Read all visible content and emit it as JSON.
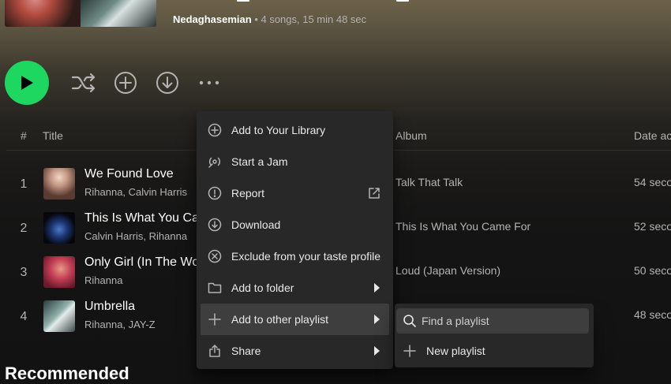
{
  "header": {
    "owner": "Nedaghasemian",
    "meta": " • 4 songs, 15 min 48 sec"
  },
  "table": {
    "col_number": "#",
    "col_title": "Title",
    "col_album": "Album",
    "col_date": "Date ac",
    "rows": [
      {
        "number": "1",
        "title": "We Found Love",
        "artists": "Rihanna, Calvin Harris",
        "album": "Talk That Talk",
        "date": "54 seco"
      },
      {
        "number": "2",
        "title": "This Is What You Car",
        "artists": "Calvin Harris, Rihanna",
        "album": "This Is What You Came For",
        "date": "52 seco"
      },
      {
        "number": "3",
        "title": "Only Girl (In The Wo",
        "artists": "Rihanna",
        "album": "Loud (Japan Version)",
        "date": "50 seco"
      },
      {
        "number": "4",
        "title": "Umbrella",
        "artists": "Rihanna, JAY-Z",
        "album": "",
        "date": "48 seco"
      }
    ]
  },
  "section": {
    "recommended": "Recommended"
  },
  "context_menu": {
    "items": [
      {
        "label": "Add to Your Library",
        "icon": "plus-circle-icon"
      },
      {
        "label": "Start a Jam",
        "icon": "jam-icon"
      },
      {
        "label": "Report",
        "icon": "report-icon"
      },
      {
        "label": "Download",
        "icon": "download-icon"
      },
      {
        "label": "Exclude from your taste profile",
        "icon": "exclude-icon"
      },
      {
        "label": "Add to folder",
        "icon": "folder-icon"
      },
      {
        "label": "Add to other playlist",
        "icon": "plus-icon"
      },
      {
        "label": "Share",
        "icon": "share-icon"
      }
    ]
  },
  "submenu": {
    "search_placeholder": "Find a playlist",
    "new_playlist": "New playlist"
  },
  "colors": {
    "accent": "#1ed760",
    "background": "#121212",
    "menu": "#282828",
    "menu_hover": "#3e3e3e"
  }
}
